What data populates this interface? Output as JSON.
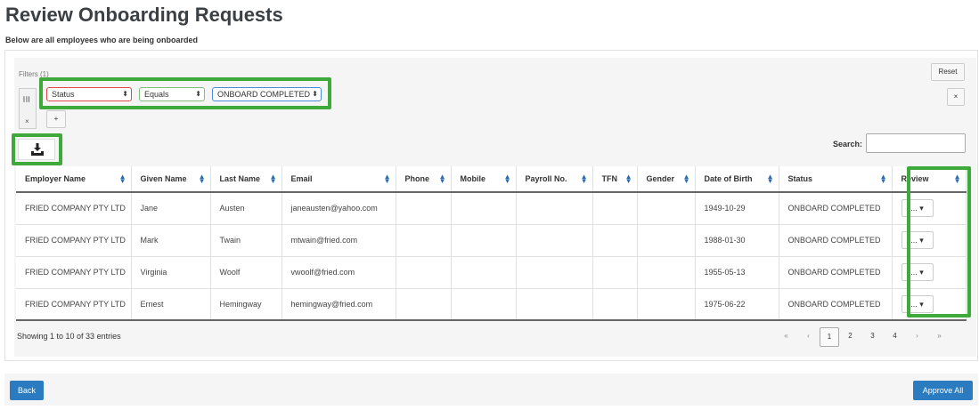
{
  "header": {
    "title": "Review Onboarding Requests",
    "subtitle": "Below are all employees who are being onboarded"
  },
  "filters": {
    "label": "Filters (1)",
    "reset_label": "Reset",
    "remove_label": "×",
    "add_label": "+",
    "group_icon": "group-icon",
    "field": "Status",
    "operator": "Equals",
    "value": "ONBOARD COMPLETED"
  },
  "toolbar": {
    "download_icon": "download-icon",
    "search_label": "Search:",
    "search_value": ""
  },
  "table": {
    "columns": [
      "Employer Name",
      "Given Name",
      "Last Name",
      "Email",
      "Phone",
      "Mobile",
      "Payroll No.",
      "TFN",
      "Gender",
      "Date of Birth",
      "Status",
      "Review"
    ],
    "rows": [
      [
        "FRIED COMPANY PTY LTD",
        "Jane",
        "Austen",
        "janeausten@yahoo.com",
        "",
        "",
        "",
        "",
        "",
        "1949-10-29",
        "ONBOARD COMPLETED",
        "..."
      ],
      [
        "FRIED COMPANY PTY LTD",
        "Mark",
        "Twain",
        "mtwain@fried.com",
        "",
        "",
        "",
        "",
        "",
        "1988-01-30",
        "ONBOARD COMPLETED",
        "..."
      ],
      [
        "FRIED COMPANY PTY LTD",
        "Virginia",
        "Woolf",
        "vwoolf@fried.com",
        "",
        "",
        "",
        "",
        "",
        "1955-05-13",
        "ONBOARD COMPLETED",
        "..."
      ],
      [
        "FRIED COMPANY PTY LTD",
        "Ernest",
        "Hemingway",
        "hemingway@fried.com",
        "",
        "",
        "",
        "",
        "",
        "1975-06-22",
        "ONBOARD COMPLETED",
        "..."
      ]
    ]
  },
  "pagination": {
    "info": "Showing 1 to 10 of 33 entries",
    "first": "«",
    "prev": "‹",
    "pages": [
      "1",
      "2",
      "3",
      "4"
    ],
    "current": "1",
    "next": "›",
    "last": "»"
  },
  "footer": {
    "back_label": "Back",
    "approve_label": "Approve All"
  },
  "colors": {
    "highlight": "#3faa3c",
    "primary": "#2a7bc0",
    "status_select_border": "#e24848",
    "operator_select_border": "#7fbf77",
    "value_select_border": "#4a8ad8"
  }
}
